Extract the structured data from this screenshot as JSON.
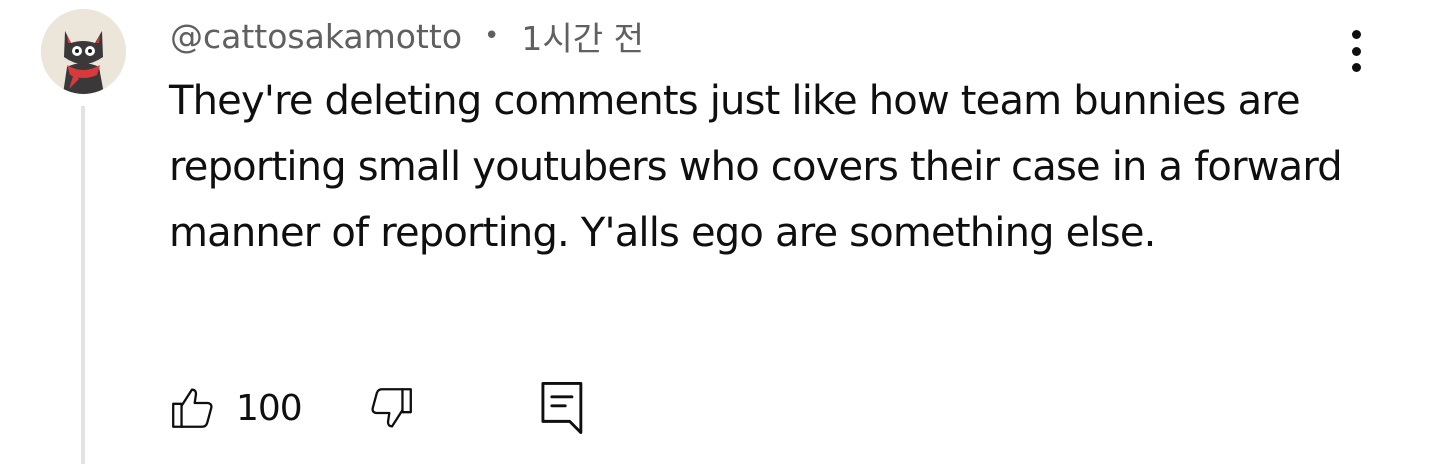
{
  "comment": {
    "author_handle": "@cattosakamotto",
    "separator": "•",
    "timestamp": "1시간 전",
    "text": "They're deleting comments just like how team bunnies are reporting small youtubers who covers their case in a forward manner of reporting. Y'alls ego are something else.",
    "avatar_icon": "black-cat-avatar-icon",
    "more_icon": "more-vertical-icon"
  },
  "actions": {
    "like_icon": "thumbs-up-icon",
    "like_count": "100",
    "dislike_icon": "thumbs-down-icon",
    "reply_icon": "comment-reply-icon"
  },
  "colors": {
    "text": "#0f0f0f",
    "meta_text": "#606060",
    "thread_line": "#e3e3e3",
    "avatar_bg": "#ebe5da"
  }
}
